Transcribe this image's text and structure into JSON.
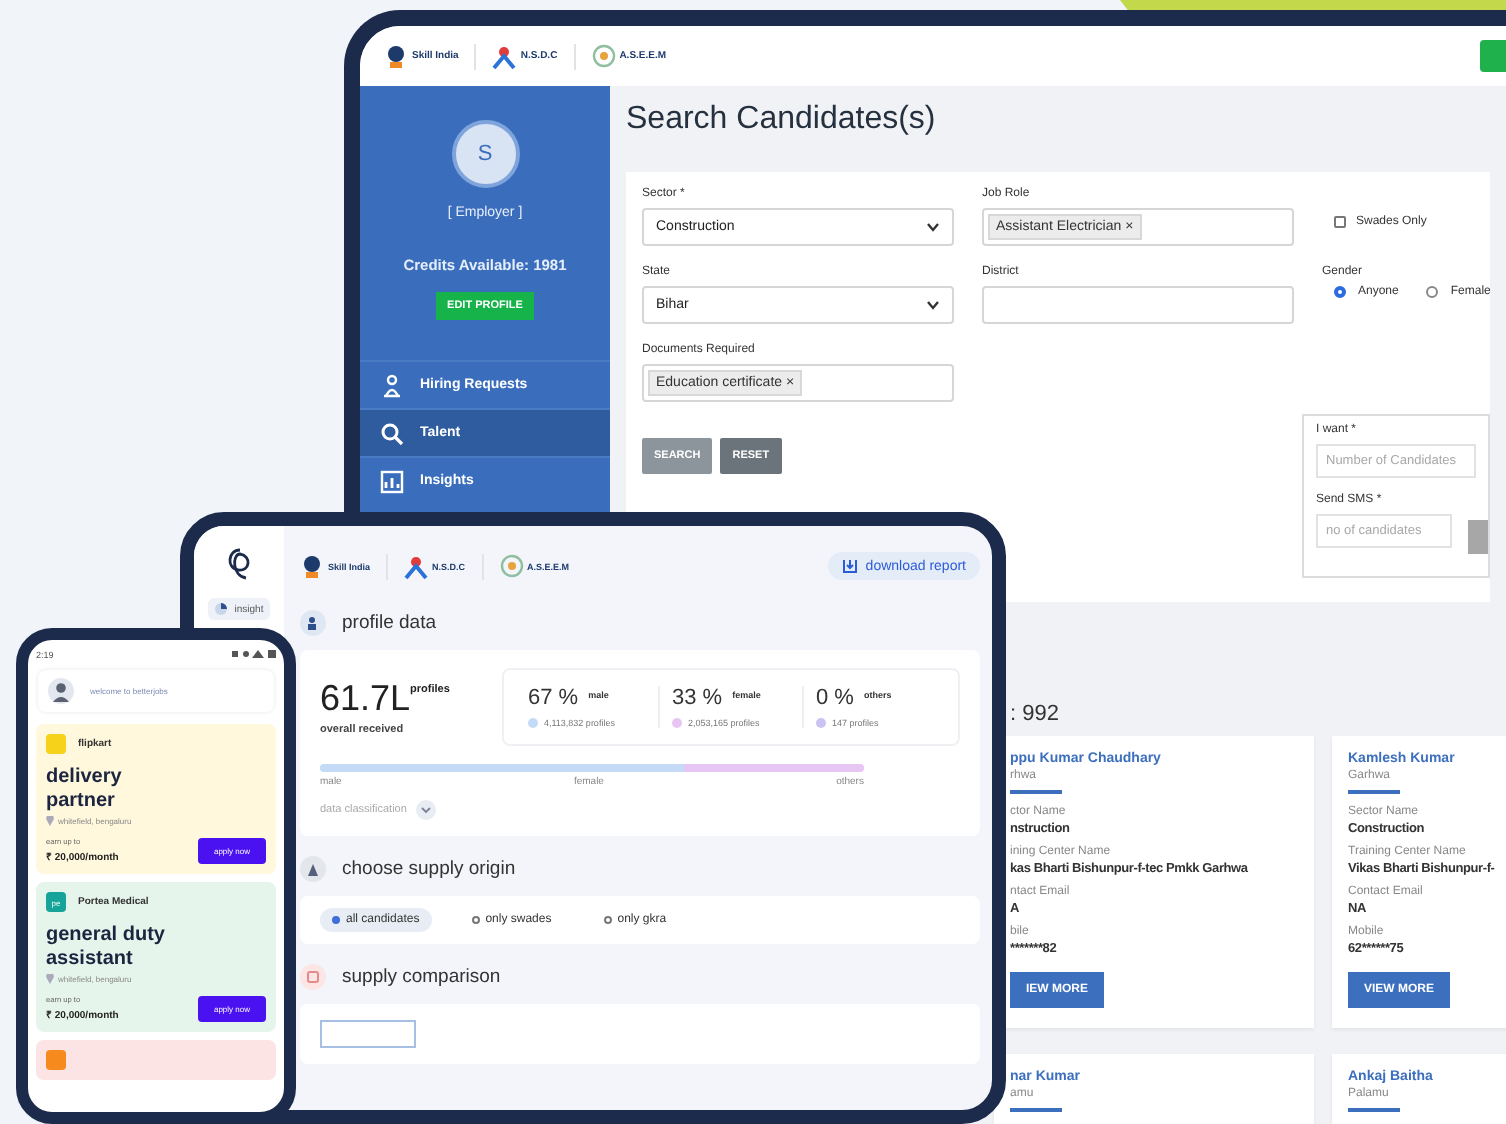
{
  "admin_window": {
    "logos": [
      {
        "text": "Skill India"
      },
      {
        "text": "N.S.D.C"
      },
      {
        "text": "A.S.E.E.M"
      }
    ],
    "sidebar": {
      "avatar": "S",
      "role": "[ Employer ]",
      "credits": "Credits Available: 1981",
      "edit_button": "EDIT PROFILE",
      "items": [
        {
          "label": "Hiring Requests",
          "selected": false
        },
        {
          "label": "Talent",
          "selected": true
        },
        {
          "label": "Insights",
          "selected": false
        }
      ]
    },
    "title": "Search Candidates(s)",
    "fields": [
      {
        "kind": "select",
        "label": "Sector *",
        "value": "Construction"
      },
      {
        "kind": "tags",
        "label": "Job Role",
        "tags": [
          "Assistant Electrician ×"
        ]
      },
      {
        "kind": "checkbox",
        "label": "Swades Only",
        "checked": false
      },
      {
        "kind": "select",
        "label": "State",
        "value": "Bihar"
      },
      {
        "kind": "text",
        "label": "District"
      },
      {
        "kind": "radio",
        "label": "Gender",
        "options": [
          {
            "label": "Anyone",
            "selected": true
          },
          {
            "label": "Female",
            "selected": false
          }
        ]
      },
      {
        "kind": "tags",
        "label": "Documents Required",
        "tags": [
          "Education certificate ×"
        ]
      }
    ],
    "buttons": [
      {
        "label": "SEARCH",
        "kind": "primary"
      },
      {
        "label": "RESET",
        "kind": "secondary"
      }
    ],
    "request_panel": [
      {
        "label": "I want *",
        "placeholder": "Number of Candidates"
      },
      {
        "label": "Send SMS *",
        "placeholder": "no of candidates"
      }
    ],
    "results_title": ": 992",
    "cards": [
      {
        "name": "ppu Kumar Chaudhary",
        "place": "rhwa",
        "details": [
          {
            "label": "ctor Name",
            "value": "nstruction"
          },
          {
            "label": "ining Center Name",
            "value": "kas Bharti Bishunpur-f-tec Pmkk Garhwa"
          },
          {
            "label": "ntact Email",
            "value": "A"
          },
          {
            "label": "bile",
            "value": "*******82"
          }
        ],
        "button": "IEW MORE"
      },
      {
        "name": "Kamlesh Kumar",
        "place": "Garhwa",
        "details": [
          {
            "label": "Sector Name",
            "value": "Construction"
          },
          {
            "label": "Training Center Name",
            "value": "Vikas Bharti Bishunpur-f-"
          },
          {
            "label": "Contact Email",
            "value": "NA"
          },
          {
            "label": "Mobile",
            "value": "62******75"
          }
        ],
        "button": "VIEW MORE"
      },
      {
        "name": "nar Kumar",
        "place": "amu"
      },
      {
        "name": "Ankaj Baitha",
        "place": "Palamu"
      }
    ]
  },
  "insight_window": {
    "sidebar_items": [
      {
        "label": "insight",
        "selected": true
      }
    ],
    "logos": [
      {
        "text": "Skill India"
      },
      {
        "text": "N.S.D.C"
      },
      {
        "text": "A.S.E.E.M"
      }
    ],
    "download_button": "download report",
    "profile_section": {
      "title": "profile data",
      "total": "61.7L",
      "total_unit": "profiles",
      "total_caption": "overall received",
      "stats": [
        {
          "percent": "67 %",
          "label": "male",
          "profiles": "4,113,832 profiles",
          "color": "#c3dbf6",
          "level": 0.67
        },
        {
          "percent": "33 %",
          "label": "female",
          "profiles": "2,053,165 profiles",
          "color": "#e8c6f4",
          "level": 0.33
        },
        {
          "percent": "0 %",
          "label": "others",
          "profiles": "147 profiles",
          "color": "#cbc3f3"
        }
      ],
      "bar_labels": [
        "male",
        "female",
        "others"
      ],
      "classification": "data classification"
    },
    "origin_section": {
      "title": "choose supply origin",
      "options": [
        {
          "label": "all candidates",
          "selected": true
        },
        {
          "label": "only swades",
          "selected": false
        },
        {
          "label": "only gkra",
          "selected": false
        }
      ]
    },
    "comparison_section": {
      "title": "supply comparison"
    }
  },
  "phone": {
    "time": "2:19",
    "welcome": "welcome to betterjobs",
    "jobs": [
      {
        "company": "flipkart",
        "title": "delivery partner",
        "location": "whitefield, bengaluru",
        "pay_caption": "earn up to",
        "pay": "₹ 20,000/month",
        "button": "apply now",
        "color": "#fff8dc"
      },
      {
        "company": "Portea Medical",
        "logo_text": "pe",
        "title": "general duty assistant",
        "location": "whitefield, bengaluru",
        "pay_caption": "earn up to",
        "pay": "₹ 20,000/month",
        "button": "apply now",
        "color": "#e6f5ec"
      },
      {
        "color": "#fde4e4"
      }
    ]
  }
}
